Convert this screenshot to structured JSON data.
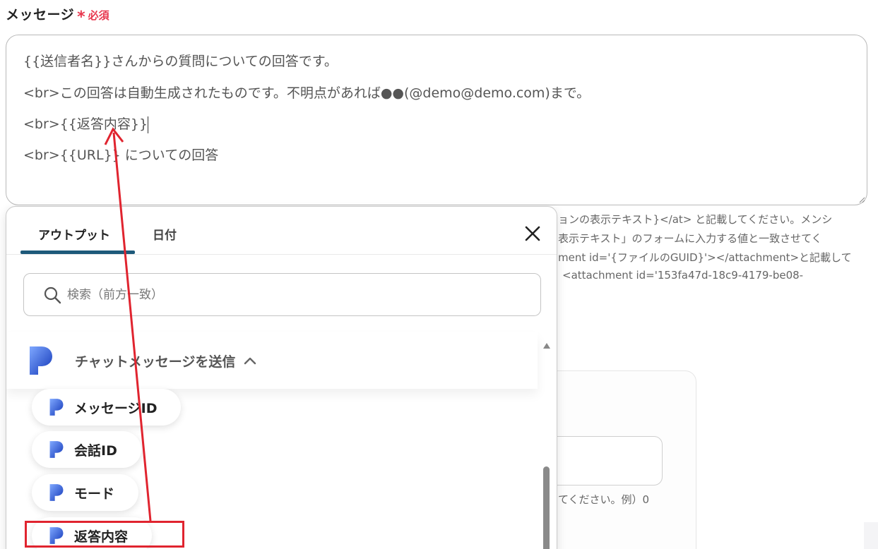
{
  "field": {
    "label": "メッセージ",
    "required_star": "*",
    "required_text": "必須"
  },
  "message": {
    "line1": "{{送信者名}}さんからの質問についての回答です。",
    "line2": "<br>この回答は自動生成されたものです。不明点があれば●●(@demo@demo.com)まで。",
    "line3": "<br>{{返答内容}}",
    "line4": "<br>{{URL}}   についての回答"
  },
  "help": {
    "line1": "ョンの表示テキスト}</at> と記載してください。メンシ",
    "line2": "表示テキスト」のフォームに入力する値と一致させてく",
    "line3": "ment id='{ファイルのGUID}'></attachment>と記載して",
    "line4": "<attachment id='153fa47d-18c9-4179-be08-",
    "line5": "てください。例）0"
  },
  "popup": {
    "tabs": [
      {
        "label": "アウトプット",
        "active": true
      },
      {
        "label": "日付",
        "active": false
      }
    ],
    "search": {
      "placeholder": "検索（前方一致）",
      "value": ""
    },
    "group": {
      "title": "チャットメッセージを送信",
      "expanded": true
    },
    "items": [
      {
        "label": "メッセージID"
      },
      {
        "label": "会話ID"
      },
      {
        "label": "モード"
      },
      {
        "label": "返答内容",
        "highlighted": true
      }
    ]
  },
  "icons": {
    "close": "close-icon",
    "search": "search-icon",
    "chevron": "chevron-up-icon",
    "app_logo": "app-logo-icon"
  },
  "colors": {
    "required": "#e8384f",
    "tab_underline": "#1e5a7a",
    "annotation": "#e0242f",
    "logo_blue": "#1a4fd0"
  }
}
